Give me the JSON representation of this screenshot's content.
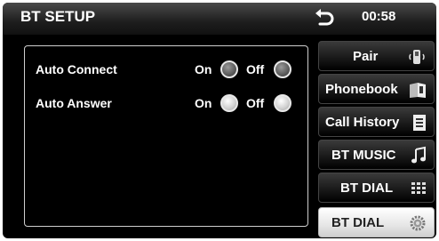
{
  "header": {
    "title": "BT SETUP",
    "clock": "00:58"
  },
  "settings": [
    {
      "label": "Auto Connect",
      "on_label": "On",
      "off_label": "Off",
      "on_selected": false,
      "off_selected": false
    },
    {
      "label": "Auto Answer",
      "on_label": "On",
      "off_label": "Off",
      "on_selected": true,
      "off_selected": true
    }
  ],
  "menu": [
    {
      "label": "Pair",
      "icon": "phone-icon",
      "active": false
    },
    {
      "label": "Phonebook",
      "icon": "book-icon",
      "active": false
    },
    {
      "label": "Call History",
      "icon": "list-icon",
      "active": false
    },
    {
      "label": "BT MUSIC",
      "icon": "music-note-icon",
      "active": false
    },
    {
      "label": "BT DIAL",
      "icon": "keypad-icon",
      "active": false
    },
    {
      "label": "BT DIAL",
      "icon": "gear-icon",
      "active": true
    }
  ]
}
